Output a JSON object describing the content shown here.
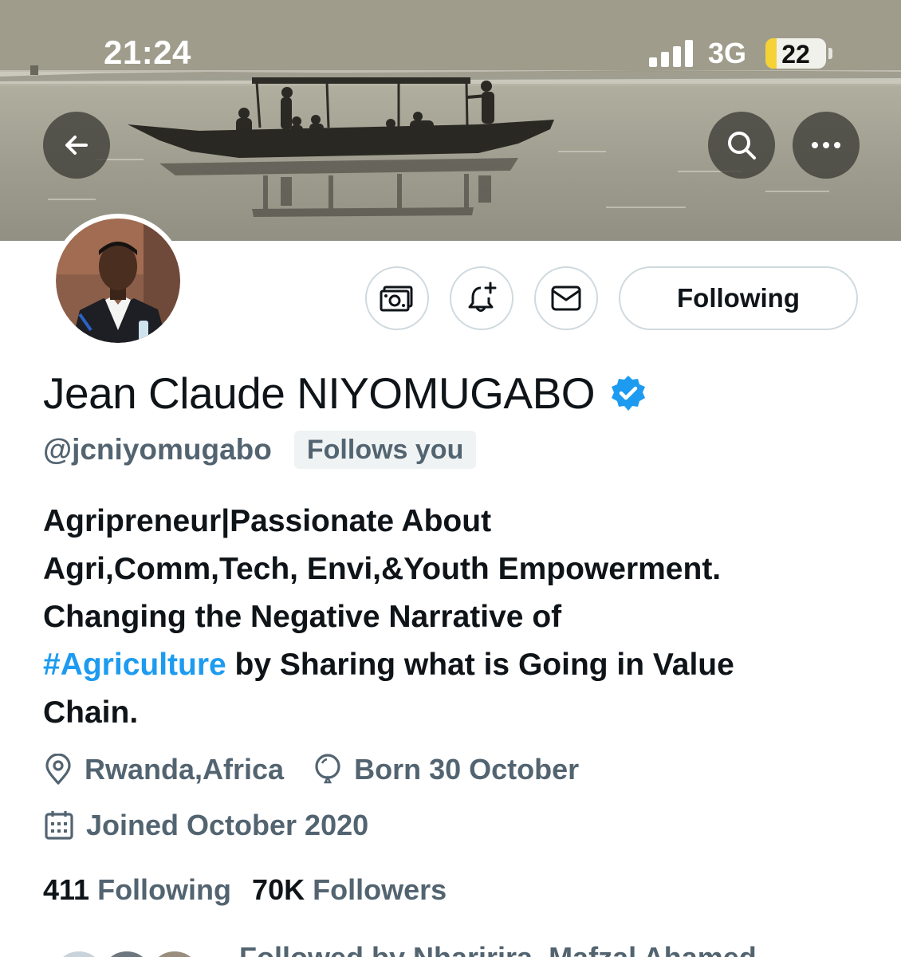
{
  "status_bar": {
    "time": "21:24",
    "network": "3G",
    "battery": "22"
  },
  "profile": {
    "display_name": "Jean Claude NIYOMUGABO",
    "handle": "@jcniyomugabo",
    "follows_you_badge": "Follows you",
    "verified": true,
    "bio_lines": [
      "Agripreneur|Passionate About",
      "Agri,Comm,Tech, Envi,&Youth Empowerment.",
      "Changing the Negative Narrative of"
    ],
    "bio_hashtag": "#Agriculture",
    "bio_after_hashtag": " by Sharing what is Going in Value",
    "bio_last_line": "Chain.",
    "location": "Rwanda,Africa",
    "birthday": "Born 30 October",
    "joined": "Joined October 2020",
    "following_count": "411",
    "following_label": "Following",
    "followers_count": "70K",
    "followers_label": "Followers",
    "followed_by": "Followed by Nharirira, Mafzal Ahamed"
  },
  "actions": {
    "following_button": "Following"
  },
  "icons": {
    "back": "arrow-left-icon",
    "search": "search-icon",
    "more": "more-horizontal-icon",
    "tip": "tip-money-icon",
    "notify": "bell-plus-icon",
    "message": "envelope-icon",
    "verified": "verified-badge-icon",
    "location": "location-pin-icon",
    "birthday": "balloon-icon",
    "calendar": "calendar-icon"
  },
  "colors": {
    "accent": "#1d9bf0",
    "secondary_text": "#536471",
    "primary_text": "#0f1419",
    "border": "#cfd9de"
  }
}
